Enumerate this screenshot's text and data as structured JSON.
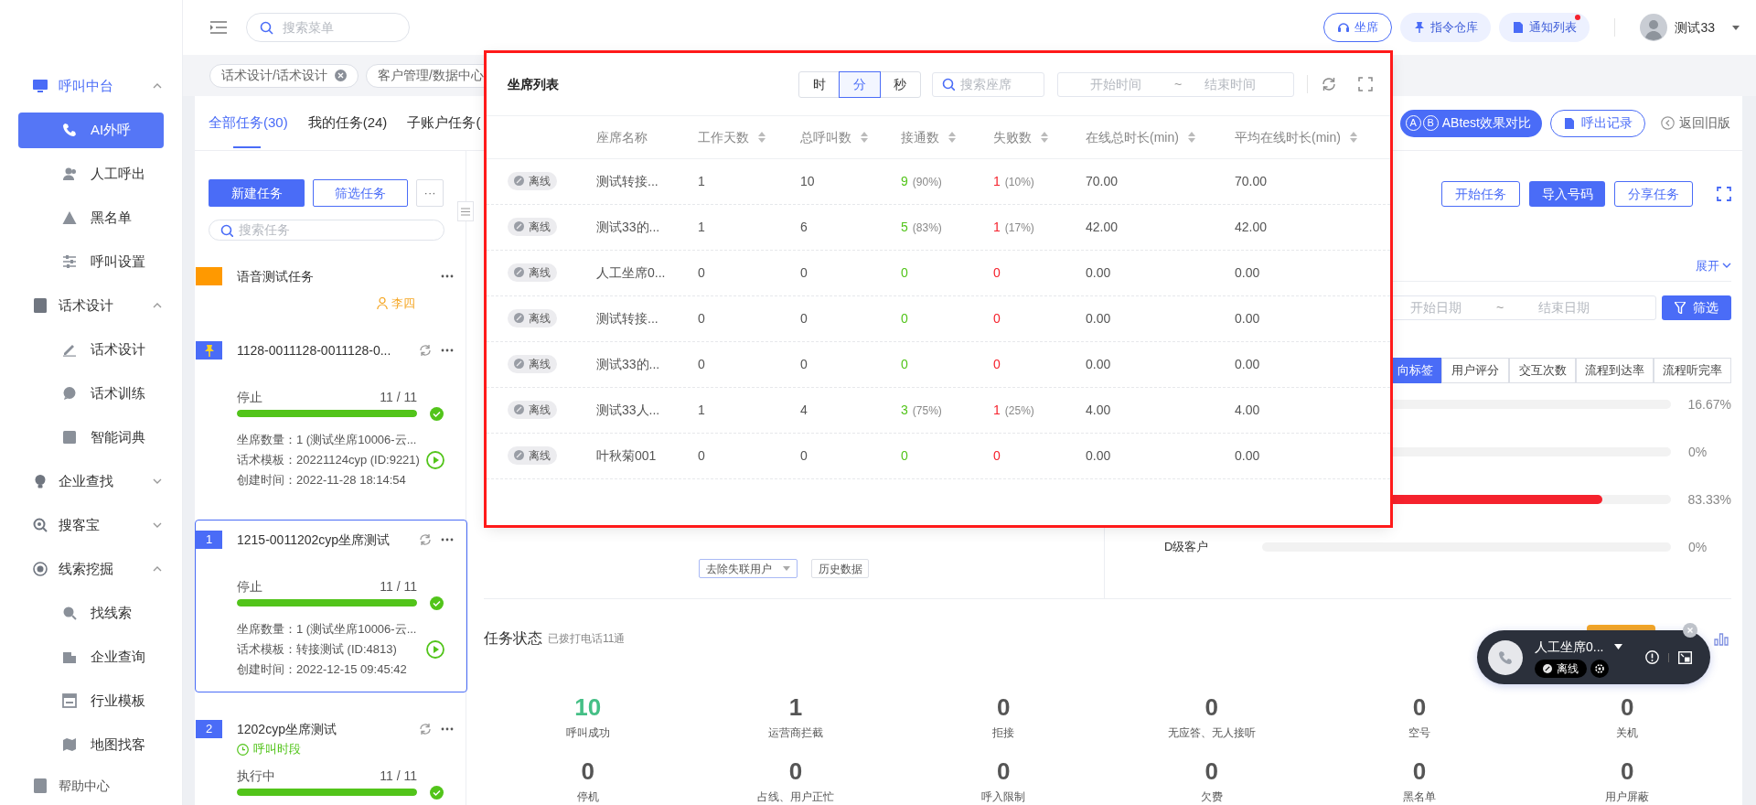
{
  "sidebar": {
    "groups": [
      {
        "label": "呼叫中台",
        "active": true,
        "expanded": true,
        "children": [
          {
            "label": "AI外呼",
            "selected": true
          },
          {
            "label": "人工呼出",
            "selected": false
          },
          {
            "label": "黑名单",
            "selected": false
          },
          {
            "label": "呼叫设置",
            "selected": false
          }
        ]
      },
      {
        "label": "话术设计",
        "active": false,
        "expanded": true,
        "children": [
          {
            "label": "话术设计",
            "selected": false
          },
          {
            "label": "话术训练",
            "selected": false
          },
          {
            "label": "智能词典",
            "selected": false
          }
        ]
      },
      {
        "label": "企业查找",
        "active": false,
        "expanded": false
      },
      {
        "label": "搜客宝",
        "active": false,
        "expanded": false
      },
      {
        "label": "线索挖掘",
        "active": false,
        "expanded": true,
        "children": [
          {
            "label": "找线索",
            "selected": false
          },
          {
            "label": "企业查询",
            "selected": false
          },
          {
            "label": "行业模板",
            "selected": false
          },
          {
            "label": "地图找客",
            "selected": false
          }
        ]
      }
    ],
    "footer": "帮助中心"
  },
  "header": {
    "search_placeholder": "搜索菜单",
    "buttons": [
      {
        "label": "坐席",
        "kind": "outline",
        "dot": false
      },
      {
        "label": "指令仓库",
        "kind": "soft",
        "dot": false
      },
      {
        "label": "通知列表",
        "kind": "soft",
        "dot": true
      }
    ],
    "user": "测试33"
  },
  "open_tabs": [
    {
      "label": "话术设计/话术设计",
      "closable": true
    },
    {
      "label": "客户管理/数据中心",
      "closable": false
    }
  ],
  "tabs": [
    {
      "label": "全部任务(30)",
      "selected": true
    },
    {
      "label": "我的任务(24)",
      "selected": false
    },
    {
      "label": "子账户任务(",
      "selected": false
    }
  ],
  "tab_actions": [
    {
      "label": "ABtest效果对比",
      "kind": "primary",
      "badges": [
        "A",
        "B"
      ]
    },
    {
      "label": "呼出记录",
      "kind": "outline"
    },
    {
      "label": "返回旧版",
      "kind": "link"
    }
  ],
  "task_panel": {
    "buttons": [
      {
        "label": "新建任务",
        "kind": "primary"
      },
      {
        "label": "筛选任务",
        "kind": "outline"
      },
      {
        "label": "···",
        "kind": "more"
      }
    ],
    "search_placeholder": "搜索任务",
    "tasks": [
      {
        "marker": {
          "kind": "block",
          "color": "#ff9900"
        },
        "title": "语音测试任务",
        "refresh": false,
        "selected": false,
        "owner": "李四"
      },
      {
        "marker": {
          "kind": "pin"
        },
        "title": "1128-0011128-0011128-0...",
        "refresh": true,
        "selected": false,
        "status": "停止",
        "count": "11 / 11",
        "level": 1,
        "done": true,
        "details": [
          "坐席数量：1 (测试坐席10006-云...",
          "话术模板：20221124cyp (ID:9221)",
          "创建时间：2022-11-28 18:14:54"
        ]
      },
      {
        "marker": {
          "kind": "number",
          "text": "1"
        },
        "title": "1215-0011202cyp坐席测试",
        "refresh": true,
        "selected": true,
        "status": "停止",
        "count": "11 / 11",
        "level": 1,
        "done": true,
        "details": [
          "坐席数量：1 (测试坐席10006-云...",
          "话术模板：转接测试 (ID:4813)",
          "创建时间：2022-12-15 09:45:42"
        ]
      },
      {
        "marker": {
          "kind": "number",
          "text": "2"
        },
        "title": "1202cyp坐席测试",
        "refresh": true,
        "selected": false,
        "schedule": "呼叫时段",
        "status": "执行中",
        "count": "11 / 11",
        "level": 1,
        "done": true
      }
    ]
  },
  "detail": {
    "actions": [
      {
        "label": "开始任务",
        "kind": "outline"
      },
      {
        "label": "导入号码",
        "kind": "primary"
      },
      {
        "label": "分享任务",
        "kind": "outline"
      }
    ],
    "expand_link": "展开",
    "chart_controls": {
      "dropdown": "去除失联用户",
      "button": "历史数据"
    },
    "date_range": {
      "start_placeholder": "开始日期",
      "separator": "~",
      "end_placeholder": "结束日期"
    },
    "filter_button": "筛选",
    "metric_tabs": [
      {
        "label": "向标签",
        "selected": true
      },
      {
        "label": "用户评分",
        "selected": false
      },
      {
        "label": "交互次数",
        "selected": false
      },
      {
        "label": "流程到达率",
        "selected": false
      },
      {
        "label": "流程听完率",
        "selected": false
      }
    ],
    "grade_bars": [
      {
        "value": "16.67%"
      },
      {
        "level": 0,
        "value": "0%"
      },
      {
        "level": 0.8333,
        "value": "83.33%"
      },
      {
        "label": "D级客户",
        "level": 0,
        "value": "0%"
      }
    ]
  },
  "task_status": {
    "title": "任务状态",
    "subtitle": "已拨打电话11通",
    "stats": [
      {
        "value": "10",
        "label": "呼叫成功",
        "color": "#45bf86"
      },
      {
        "value": "1",
        "label": "运营商拦截",
        "color": "#555555"
      },
      {
        "value": "0",
        "label": "拒接",
        "color": "#555555"
      },
      {
        "value": "0",
        "label": "无应答、无人接听",
        "color": "#555555"
      },
      {
        "value": "0",
        "label": "空号",
        "color": "#555555"
      },
      {
        "value": "0",
        "label": "关机",
        "color": "#555555"
      },
      {
        "value": "0",
        "label": "停机",
        "color": "#555555"
      },
      {
        "value": "0",
        "label": "占线、用户正忙",
        "color": "#555555"
      },
      {
        "value": "0",
        "label": "呼入限制",
        "color": "#555555"
      },
      {
        "value": "0",
        "label": "欠费",
        "color": "#555555"
      },
      {
        "value": "0",
        "label": "黑名单",
        "color": "#555555"
      },
      {
        "value": "0",
        "label": "用户屏蔽",
        "color": "#555555"
      }
    ]
  },
  "seat_list_popup": {
    "title": "坐席列表",
    "units": [
      {
        "label": "时",
        "selected": false
      },
      {
        "label": "分",
        "selected": true
      },
      {
        "label": "秒",
        "selected": false
      }
    ],
    "search_placeholder": "搜索座席",
    "time_range": {
      "start_placeholder": "开始时间",
      "separator": "~",
      "end_placeholder": "结束时间"
    },
    "columns": [
      {
        "label": "座席名称",
        "sortable": false
      },
      {
        "label": "工作天数",
        "sortable": true
      },
      {
        "label": "总呼叫数",
        "sortable": true
      },
      {
        "label": "接通数",
        "sortable": true
      },
      {
        "label": "失败数",
        "sortable": true
      },
      {
        "label": "在线总时长(min)",
        "sortable": true
      },
      {
        "label": "平均在线时长(min)",
        "sortable": true
      }
    ],
    "rows": [
      {
        "status": "离线",
        "name": "测试转接...",
        "work_days": "1",
        "total_calls": "10",
        "connected": "9",
        "connected_pct": "(90%)",
        "failed": "1",
        "failed_pct": "(10%)",
        "online_total": "70.00",
        "online_avg": "70.00"
      },
      {
        "status": "离线",
        "name": "测试33的...",
        "work_days": "1",
        "total_calls": "6",
        "connected": "5",
        "connected_pct": "(83%)",
        "failed": "1",
        "failed_pct": "(17%)",
        "online_total": "42.00",
        "online_avg": "42.00"
      },
      {
        "status": "离线",
        "name": "人工坐席0...",
        "work_days": "0",
        "total_calls": "0",
        "connected": "0",
        "failed": "0",
        "online_total": "0.00",
        "online_avg": "0.00"
      },
      {
        "status": "离线",
        "name": "测试转接...",
        "work_days": "0",
        "total_calls": "0",
        "connected": "0",
        "failed": "0",
        "online_total": "0.00",
        "online_avg": "0.00"
      },
      {
        "status": "离线",
        "name": "测试33的...",
        "work_days": "0",
        "total_calls": "0",
        "connected": "0",
        "failed": "0",
        "online_total": "0.00",
        "online_avg": "0.00"
      },
      {
        "status": "离线",
        "name": "测试33人...",
        "work_days": "1",
        "total_calls": "4",
        "connected": "3",
        "connected_pct": "(75%)",
        "failed": "1",
        "failed_pct": "(25%)",
        "online_total": "4.00",
        "online_avg": "4.00"
      },
      {
        "status": "离线",
        "name": "叶秋菊001",
        "work_days": "0",
        "total_calls": "0",
        "connected": "0",
        "failed": "0",
        "online_total": "0.00",
        "online_avg": "0.00"
      }
    ]
  },
  "call_widget": {
    "name": "人工坐席0...",
    "status": "离线"
  }
}
